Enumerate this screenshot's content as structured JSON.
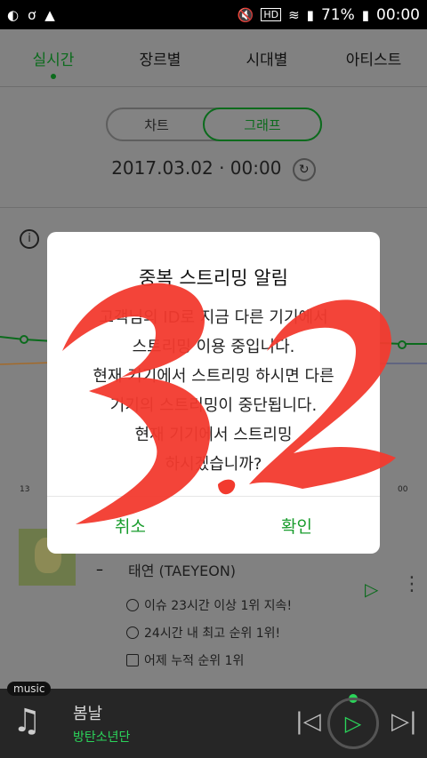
{
  "status_bar": {
    "battery": "71%",
    "time": "00:00"
  },
  "tabs": [
    "실시간",
    "장르별",
    "시대별",
    "아티스트"
  ],
  "toggle": {
    "chart": "차트",
    "graph": "그래프"
  },
  "datetime": "2017.03.02 · 00:00",
  "chart_axis": {
    "left": "13",
    "right": "00"
  },
  "song": {
    "artist": "태연 (TAEYEON)",
    "bullets": [
      "이슈 23시간 이상 1위 지속!",
      "24시간 내 최고 순위 1위!",
      "어제 누적 순위 1위"
    ]
  },
  "player": {
    "tag": "music",
    "title": "봄날",
    "artist": "방탄소년단"
  },
  "dialog": {
    "title": "중복 스트리밍 알림",
    "body": [
      "고객님의 ID로 지금 다른 기기에서",
      "스트리밍 이용 중입니다.",
      "현재 기기에서 스트리밍 하시면 다른",
      "기기의 스트리밍이 중단됩니다.",
      "현재 기기에서 스트리밍",
      "하시겠습니까?"
    ],
    "cancel": "취소",
    "confirm": "확인"
  },
  "colors": {
    "accent_green": "#1a9d2e",
    "scribble_red": "#f23a2e"
  }
}
